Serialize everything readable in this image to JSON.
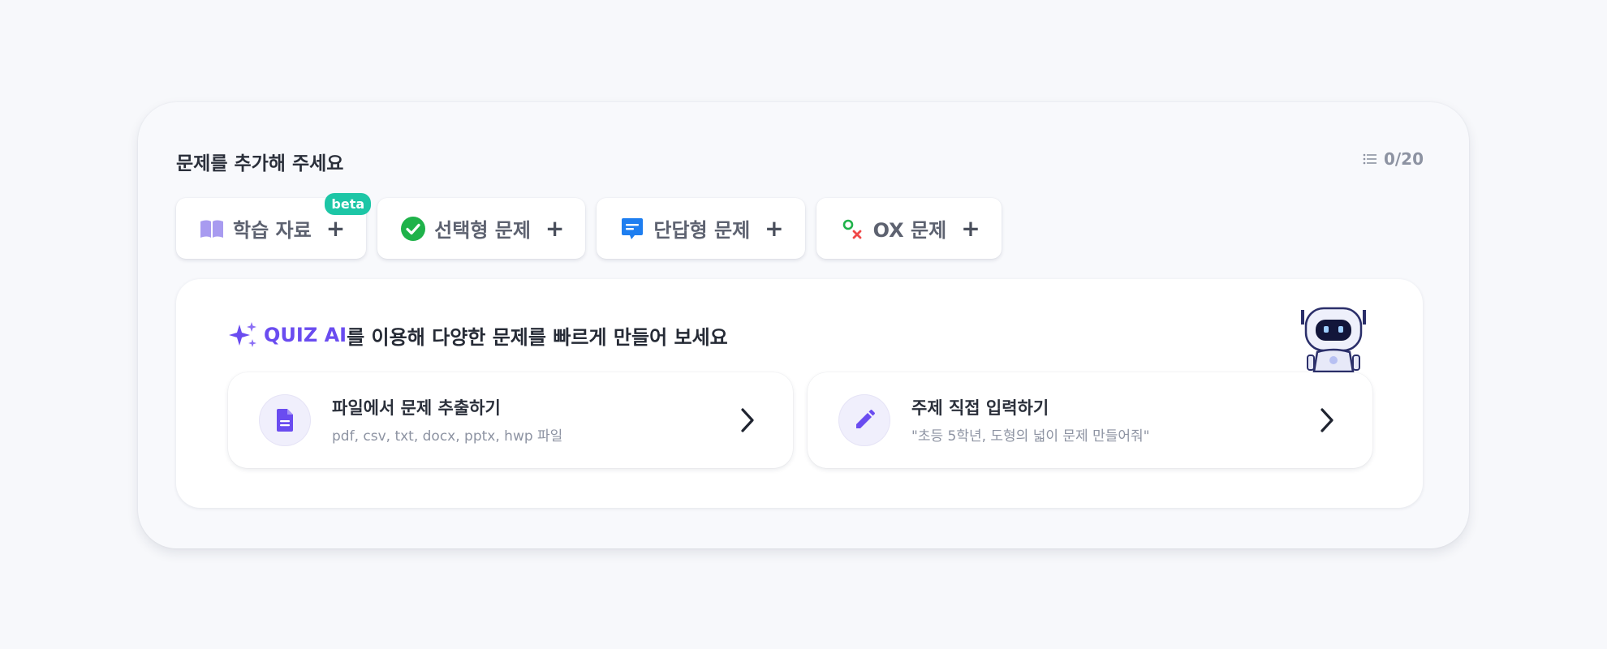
{
  "header": {
    "title": "문제를 추가해 주세요",
    "counter": "0/20"
  },
  "question_types": [
    {
      "label": "학습 자료",
      "icon": "book-icon",
      "badge": "beta",
      "plus": "+"
    },
    {
      "label": "선택형 문제",
      "icon": "check-circle-icon",
      "plus": "+"
    },
    {
      "label": "단답형 문제",
      "icon": "chat-bubble-icon",
      "plus": "+"
    },
    {
      "label": "OX 문제",
      "icon": "ox-icon",
      "plus": "+"
    }
  ],
  "ai_panel": {
    "brand": "QUIZ AI",
    "headline_rest": "를 이용해 다양한 문제를 빠르게 만들어 보세요",
    "options": [
      {
        "title": "파일에서 문제 추출하기",
        "description": "pdf, csv, txt, docx, pptx, hwp 파일",
        "icon": "document-icon"
      },
      {
        "title": "주제 직접 입력하기",
        "description": "\"초등 5학년, 도형의 넓이 문제 만들어줘\"",
        "icon": "pencil-icon"
      }
    ]
  },
  "colors": {
    "brand": "#6a4cf0",
    "beta": "#1dc6a6",
    "check": "#1fb24a",
    "chat": "#1e7ef0",
    "book": "#a89bf0"
  }
}
